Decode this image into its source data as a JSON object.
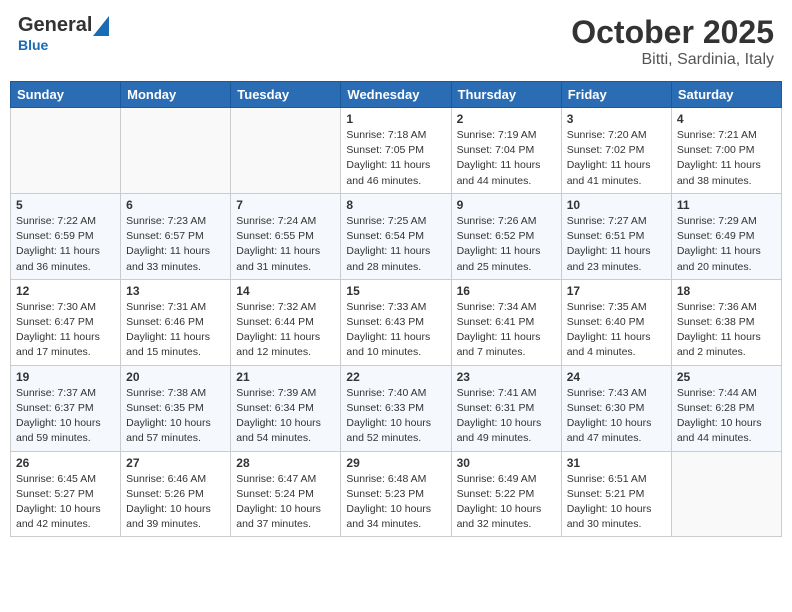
{
  "header": {
    "logo_general": "General",
    "logo_blue": "Blue",
    "month": "October 2025",
    "location": "Bitti, Sardinia, Italy"
  },
  "weekdays": [
    "Sunday",
    "Monday",
    "Tuesday",
    "Wednesday",
    "Thursday",
    "Friday",
    "Saturday"
  ],
  "weeks": [
    [
      {
        "day": "",
        "info": ""
      },
      {
        "day": "",
        "info": ""
      },
      {
        "day": "",
        "info": ""
      },
      {
        "day": "1",
        "info": "Sunrise: 7:18 AM\nSunset: 7:05 PM\nDaylight: 11 hours\nand 46 minutes."
      },
      {
        "day": "2",
        "info": "Sunrise: 7:19 AM\nSunset: 7:04 PM\nDaylight: 11 hours\nand 44 minutes."
      },
      {
        "day": "3",
        "info": "Sunrise: 7:20 AM\nSunset: 7:02 PM\nDaylight: 11 hours\nand 41 minutes."
      },
      {
        "day": "4",
        "info": "Sunrise: 7:21 AM\nSunset: 7:00 PM\nDaylight: 11 hours\nand 38 minutes."
      }
    ],
    [
      {
        "day": "5",
        "info": "Sunrise: 7:22 AM\nSunset: 6:59 PM\nDaylight: 11 hours\nand 36 minutes."
      },
      {
        "day": "6",
        "info": "Sunrise: 7:23 AM\nSunset: 6:57 PM\nDaylight: 11 hours\nand 33 minutes."
      },
      {
        "day": "7",
        "info": "Sunrise: 7:24 AM\nSunset: 6:55 PM\nDaylight: 11 hours\nand 31 minutes."
      },
      {
        "day": "8",
        "info": "Sunrise: 7:25 AM\nSunset: 6:54 PM\nDaylight: 11 hours\nand 28 minutes."
      },
      {
        "day": "9",
        "info": "Sunrise: 7:26 AM\nSunset: 6:52 PM\nDaylight: 11 hours\nand 25 minutes."
      },
      {
        "day": "10",
        "info": "Sunrise: 7:27 AM\nSunset: 6:51 PM\nDaylight: 11 hours\nand 23 minutes."
      },
      {
        "day": "11",
        "info": "Sunrise: 7:29 AM\nSunset: 6:49 PM\nDaylight: 11 hours\nand 20 minutes."
      }
    ],
    [
      {
        "day": "12",
        "info": "Sunrise: 7:30 AM\nSunset: 6:47 PM\nDaylight: 11 hours\nand 17 minutes."
      },
      {
        "day": "13",
        "info": "Sunrise: 7:31 AM\nSunset: 6:46 PM\nDaylight: 11 hours\nand 15 minutes."
      },
      {
        "day": "14",
        "info": "Sunrise: 7:32 AM\nSunset: 6:44 PM\nDaylight: 11 hours\nand 12 minutes."
      },
      {
        "day": "15",
        "info": "Sunrise: 7:33 AM\nSunset: 6:43 PM\nDaylight: 11 hours\nand 10 minutes."
      },
      {
        "day": "16",
        "info": "Sunrise: 7:34 AM\nSunset: 6:41 PM\nDaylight: 11 hours\nand 7 minutes."
      },
      {
        "day": "17",
        "info": "Sunrise: 7:35 AM\nSunset: 6:40 PM\nDaylight: 11 hours\nand 4 minutes."
      },
      {
        "day": "18",
        "info": "Sunrise: 7:36 AM\nSunset: 6:38 PM\nDaylight: 11 hours\nand 2 minutes."
      }
    ],
    [
      {
        "day": "19",
        "info": "Sunrise: 7:37 AM\nSunset: 6:37 PM\nDaylight: 10 hours\nand 59 minutes."
      },
      {
        "day": "20",
        "info": "Sunrise: 7:38 AM\nSunset: 6:35 PM\nDaylight: 10 hours\nand 57 minutes."
      },
      {
        "day": "21",
        "info": "Sunrise: 7:39 AM\nSunset: 6:34 PM\nDaylight: 10 hours\nand 54 minutes."
      },
      {
        "day": "22",
        "info": "Sunrise: 7:40 AM\nSunset: 6:33 PM\nDaylight: 10 hours\nand 52 minutes."
      },
      {
        "day": "23",
        "info": "Sunrise: 7:41 AM\nSunset: 6:31 PM\nDaylight: 10 hours\nand 49 minutes."
      },
      {
        "day": "24",
        "info": "Sunrise: 7:43 AM\nSunset: 6:30 PM\nDaylight: 10 hours\nand 47 minutes."
      },
      {
        "day": "25",
        "info": "Sunrise: 7:44 AM\nSunset: 6:28 PM\nDaylight: 10 hours\nand 44 minutes."
      }
    ],
    [
      {
        "day": "26",
        "info": "Sunrise: 6:45 AM\nSunset: 5:27 PM\nDaylight: 10 hours\nand 42 minutes."
      },
      {
        "day": "27",
        "info": "Sunrise: 6:46 AM\nSunset: 5:26 PM\nDaylight: 10 hours\nand 39 minutes."
      },
      {
        "day": "28",
        "info": "Sunrise: 6:47 AM\nSunset: 5:24 PM\nDaylight: 10 hours\nand 37 minutes."
      },
      {
        "day": "29",
        "info": "Sunrise: 6:48 AM\nSunset: 5:23 PM\nDaylight: 10 hours\nand 34 minutes."
      },
      {
        "day": "30",
        "info": "Sunrise: 6:49 AM\nSunset: 5:22 PM\nDaylight: 10 hours\nand 32 minutes."
      },
      {
        "day": "31",
        "info": "Sunrise: 6:51 AM\nSunset: 5:21 PM\nDaylight: 10 hours\nand 30 minutes."
      },
      {
        "day": "",
        "info": ""
      }
    ]
  ]
}
